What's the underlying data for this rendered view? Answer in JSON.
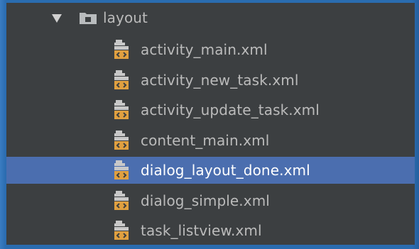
{
  "tree": {
    "folder": {
      "label": "layout",
      "icon": "folder-icon",
      "expanded": true,
      "expand_icon": "chevron-down-icon"
    },
    "files": [
      {
        "label": "activity_main.xml",
        "icon": "layout-xml-file-icon",
        "selected": false
      },
      {
        "label": "activity_new_task.xml",
        "icon": "layout-xml-file-icon",
        "selected": false
      },
      {
        "label": "activity_update_task.xml",
        "icon": "layout-xml-file-icon",
        "selected": false
      },
      {
        "label": "content_main.xml",
        "icon": "layout-xml-file-icon",
        "selected": false
      },
      {
        "label": "dialog_layout_done.xml",
        "icon": "layout-xml-file-icon",
        "selected": true
      },
      {
        "label": "dialog_simple.xml",
        "icon": "layout-xml-file-icon",
        "selected": false
      },
      {
        "label": "task_listview.xml",
        "icon": "layout-xml-file-icon",
        "selected": false
      }
    ]
  },
  "colors": {
    "panel_bg": "#3c3f41",
    "selection_bg": "#4b6eaf",
    "text": "#bbbbbb",
    "xml_icon_orange": "#e0a040",
    "frame_blue": "#2a6cb0"
  }
}
